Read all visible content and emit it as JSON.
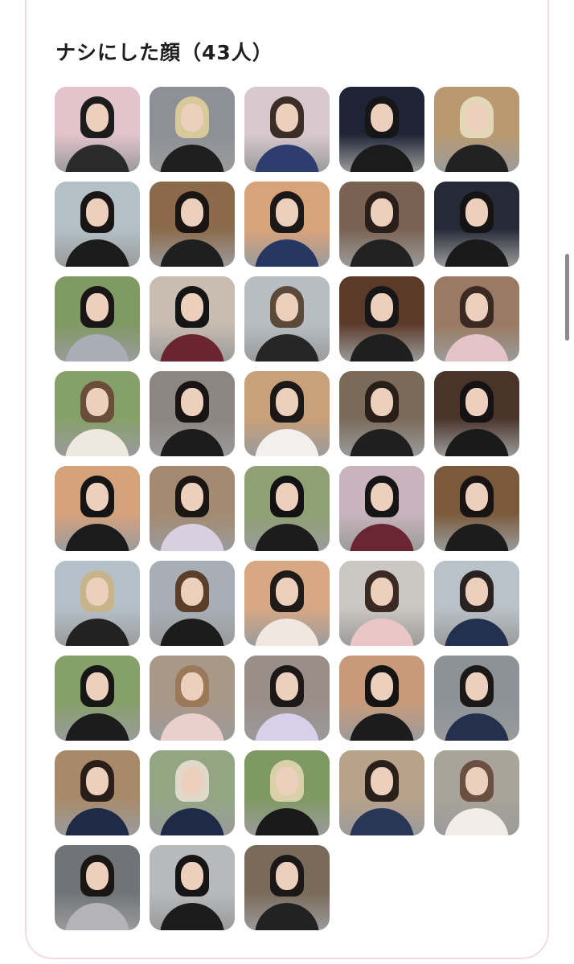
{
  "title": "ナシにした顔（43人）",
  "faces": [
    {
      "bg": "#e3c4cd",
      "top": "#2a2a2a",
      "hair": "#1c1c1c"
    },
    {
      "bg": "#8d9096",
      "top": "#1f1f1f",
      "hair": "#d8c99a"
    },
    {
      "bg": "#d9c9cf",
      "top": "#2c3d6e",
      "hair": "#3a2e27"
    },
    {
      "bg": "#1e2436",
      "top": "#1b1b1b",
      "hair": "#161616"
    },
    {
      "bg": "#b99a70",
      "top": "#222222",
      "hair": "#e2d8b8"
    },
    {
      "bg": "#b3c1c6",
      "top": "#1c1c1c",
      "hair": "#1a1515"
    },
    {
      "bg": "#8a6a4a",
      "top": "#1f1f1f",
      "hair": "#1a1412"
    },
    {
      "bg": "#d9a37a",
      "top": "#263763",
      "hair": "#1c1818"
    },
    {
      "bg": "#7a6252",
      "top": "#222222",
      "hair": "#2a1e1a"
    },
    {
      "bg": "#262a38",
      "top": "#1a1a1a",
      "hair": "#141414"
    },
    {
      "bg": "#7f9a63",
      "top": "#a9aeb6",
      "hair": "#1a1616"
    },
    {
      "bg": "#c9bdb1",
      "top": "#6b2530",
      "hair": "#151515"
    },
    {
      "bg": "#b6bec4",
      "top": "#262626",
      "hair": "#5b4a3a"
    },
    {
      "bg": "#5b3a2a",
      "top": "#1f1f1f",
      "hair": "#161616"
    },
    {
      "bg": "#9a7a62",
      "top": "#e4c4c8",
      "hair": "#3a2a22"
    },
    {
      "bg": "#86a06a",
      "top": "#efe8e0",
      "hair": "#6a4e3a"
    },
    {
      "bg": "#8c8580",
      "top": "#1c1c1c",
      "hair": "#181414"
    },
    {
      "bg": "#c8a07a",
      "top": "#f2f0ee",
      "hair": "#1c1818"
    },
    {
      "bg": "#7a6a5a",
      "top": "#1f1f1f",
      "hair": "#2a1e18"
    },
    {
      "bg": "#4a342a",
      "top": "#1a1a1a",
      "hair": "#141212"
    },
    {
      "bg": "#d6a27c",
      "top": "#1b1b1b",
      "hair": "#151515"
    },
    {
      "bg": "#a48a70",
      "top": "#d8d0e0",
      "hair": "#1a1614"
    },
    {
      "bg": "#8fa072",
      "top": "#1c1c1c",
      "hair": "#121212"
    },
    {
      "bg": "#c9b4bd",
      "top": "#6a2632",
      "hair": "#151515"
    },
    {
      "bg": "#7a5a3a",
      "top": "#1c1c1c",
      "hair": "#181414"
    },
    {
      "bg": "#b4c0c8",
      "top": "#222222",
      "hair": "#c8b48a"
    },
    {
      "bg": "#a8aeb6",
      "top": "#1c1c1c",
      "hair": "#5a3e2a"
    },
    {
      "bg": "#d8a884",
      "top": "#f0e8e0",
      "hair": "#201a18"
    },
    {
      "bg": "#cbc7c2",
      "top": "#eac6c6",
      "hair": "#3a2a22"
    },
    {
      "bg": "#b9c2c8",
      "top": "#233050",
      "hair": "#2a2220"
    },
    {
      "bg": "#86a06a",
      "top": "#1c1c1c",
      "hair": "#161616"
    },
    {
      "bg": "#a89888",
      "top": "#ead0cc",
      "hair": "#9a7858"
    },
    {
      "bg": "#9a8e88",
      "top": "#d8d0ea",
      "hair": "#1c1818"
    },
    {
      "bg": "#c89a7a",
      "top": "#1c1c1c",
      "hair": "#141414"
    },
    {
      "bg": "#8c9298",
      "top": "#24304e",
      "hair": "#1c1818"
    },
    {
      "bg": "#a88a6a",
      "top": "#1e2a48",
      "hair": "#2a1e1a"
    },
    {
      "bg": "#92a684",
      "top": "#1e2a48",
      "hair": "#e0d8c8"
    },
    {
      "bg": "#7e9a62",
      "top": "#1a1a1a",
      "hair": "#d8d0a8"
    },
    {
      "bg": "#b8a28a",
      "top": "#2a3656",
      "hair": "#2a201a"
    },
    {
      "bg": "#a8a49a",
      "top": "#f2ece6",
      "hair": "#6a5040"
    },
    {
      "bg": "#707478",
      "top": "#b4b4b8",
      "hair": "#1a1614"
    },
    {
      "bg": "#b7b9bb",
      "top": "#1c1c1c",
      "hair": "#161414"
    },
    {
      "bg": "#7a6a5a",
      "top": "#222222",
      "hair": "#1c1818"
    }
  ]
}
